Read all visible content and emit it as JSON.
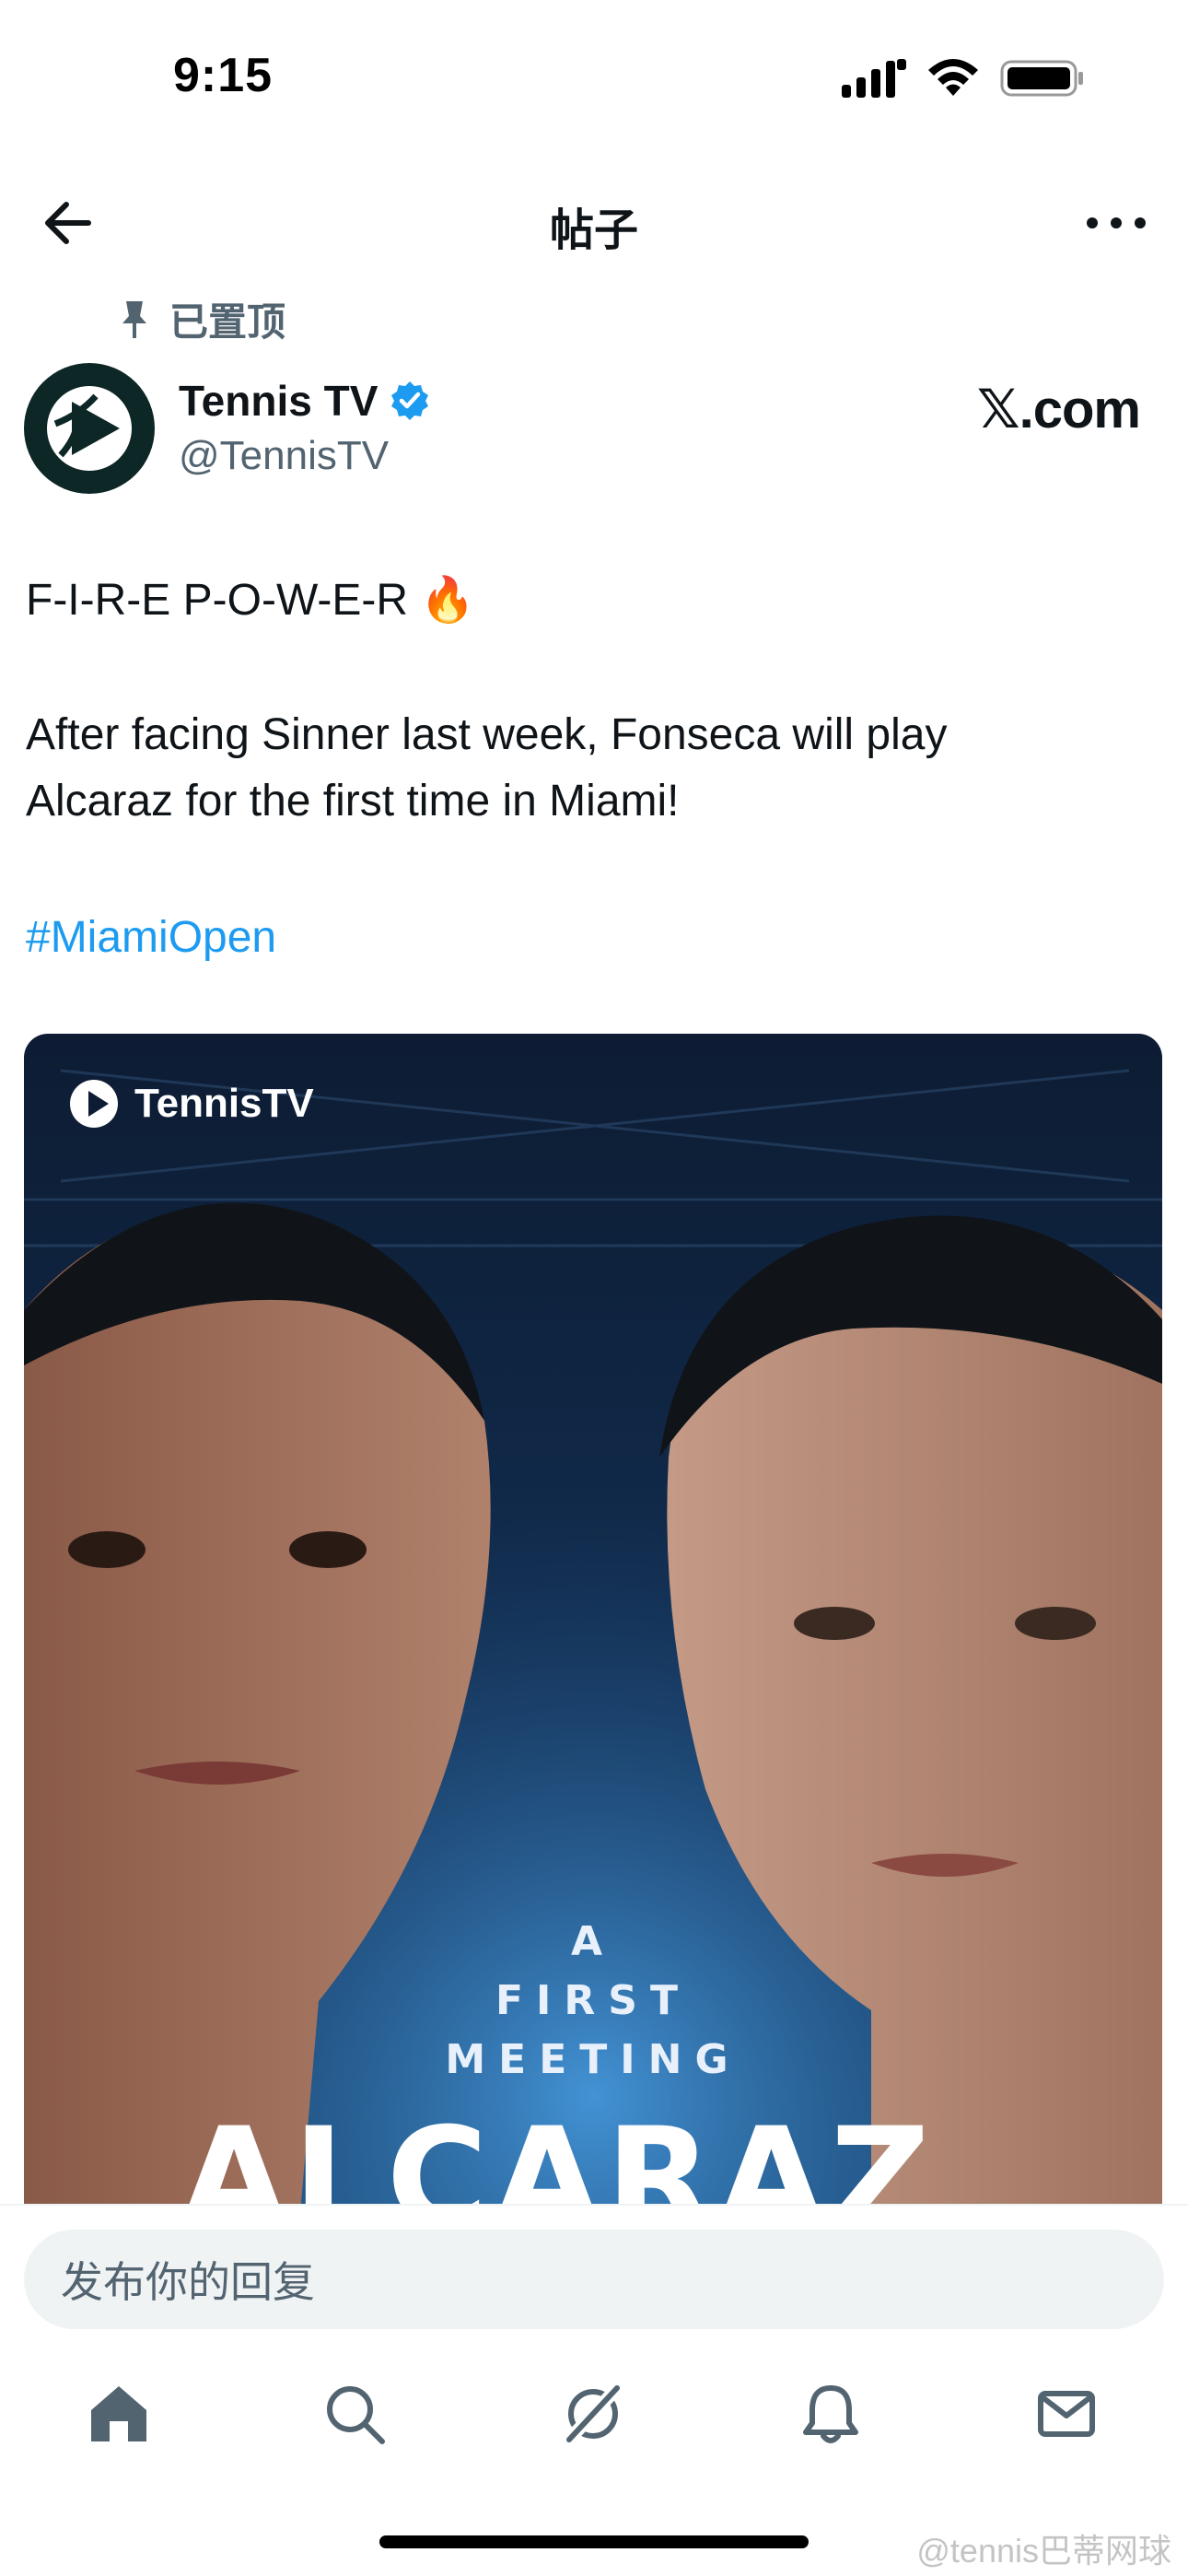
{
  "status_bar": {
    "time": "9:15"
  },
  "nav": {
    "title": "帖子",
    "back_icon": "arrow-left-icon",
    "more_icon": "more-horizontal-icon"
  },
  "post": {
    "pinned_label": "已置顶",
    "author": {
      "name": "Tennis TV",
      "handle": "@TennisTV",
      "verified": true
    },
    "source_badge": "𝕏.com",
    "text_lines": [
      "F-I-R-E P-O-W-E-R 🔥",
      "After facing Sinner last week, Fonseca will play",
      "Alcaraz for the first time in Miami!"
    ],
    "hashtag": "#MiamiOpen",
    "media": {
      "logo_text": "TennisTV",
      "tagline": [
        "A",
        "FIRST",
        "MEETING"
      ],
      "player_name": "ALCARAZ"
    }
  },
  "reply": {
    "placeholder": "发布你的回复"
  },
  "tabs": [
    {
      "icon": "home-icon"
    },
    {
      "icon": "search-icon"
    },
    {
      "icon": "grok-icon"
    },
    {
      "icon": "bell-icon"
    },
    {
      "icon": "mail-icon"
    }
  ],
  "watermark": "@tennis巴蒂网球",
  "colors": {
    "accent": "#1d9bf0",
    "text": "#0f1419",
    "secondary": "#536471"
  }
}
